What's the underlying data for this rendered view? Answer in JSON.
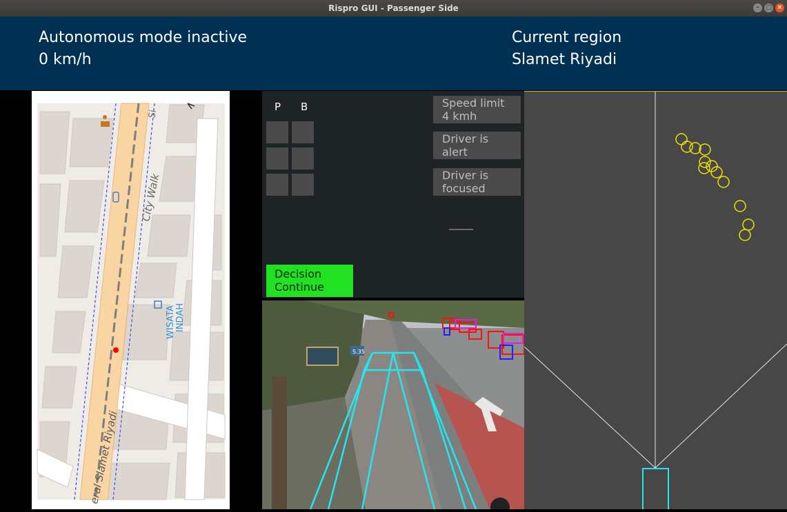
{
  "window": {
    "title": "Rispro GUI - Passenger Side"
  },
  "header": {
    "mode_status": "Autonomous mode inactive",
    "speed": "0 km/h",
    "region_label": "Current region",
    "region_name": "Slamet Riyadi"
  },
  "map": {
    "labels": {
      "street_main": "eral Slamet Riyadi",
      "city_walk": "City Walk",
      "wisata": "WISATA",
      "indah": "INDAH",
      "si": "Si"
    }
  },
  "controls": {
    "p_label": "P",
    "b_label": "B",
    "speed_limit_line1": "Speed limit",
    "speed_limit_line2": "4 kmh",
    "driver_alert_line1": "Driver is",
    "driver_alert_line2": "alert",
    "driver_focused_line1": "Driver is",
    "driver_focused_line2": "focused",
    "decision_line1": "Decision",
    "decision_line2": "Continue"
  },
  "camera": {
    "sign_label": "S.35"
  },
  "colors": {
    "header_bg": "#003153",
    "decision_bg": "#22e022",
    "lane_overlay": "#22e6f0",
    "radar_points": "#f0e000",
    "detection_box": "#ff1010"
  }
}
